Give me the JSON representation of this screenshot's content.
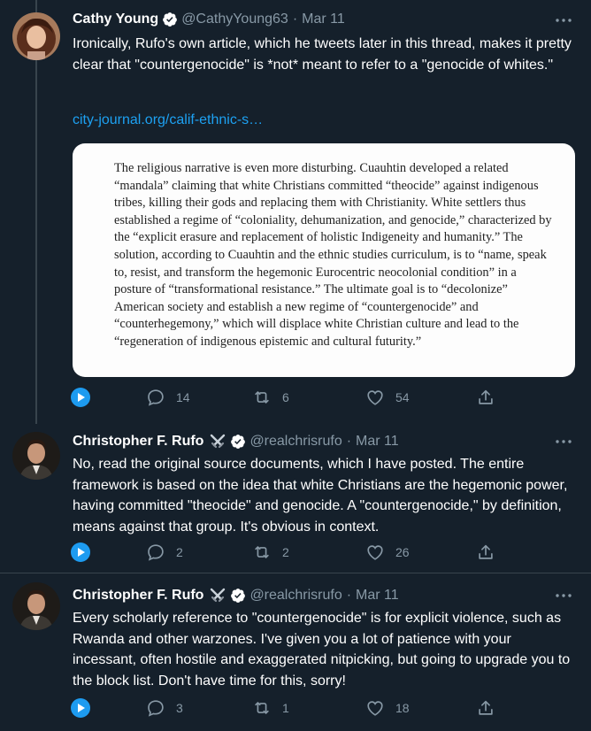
{
  "tweets": [
    {
      "name": "Cathy Young",
      "handle": "@CathyYoung63",
      "dot": "·",
      "date": "Mar 11",
      "text": "Ironically, Rufo's own article, which he tweets later in this thread, makes it pretty clear that \"countergenocide\" is *not* meant to refer to a \"genocide of whites.\"",
      "link": "city-journal.org/calif-ethnic-s…",
      "media_text": "The religious narrative is even more disturbing. Cuauhtin developed a related “mandala” claiming that white Christians committed “theocide” against indigenous tribes, killing their gods and replacing them with Christianity. White settlers thus established a regime of “coloniality, dehumanization, and genocide,” characterized by the “explicit erasure and replacement of holistic Indigeneity and humanity.” The solution, according to Cuauhtin and the ethnic studies curriculum, is to “name, speak to, resist, and transform the hegemonic Eurocentric neocolonial condition” in a posture of “transformational resistance.” The ultimate goal is to “decolonize” American society and establish a new regime of “countergenocide” and “counterhegemony,” which will displace white Christian culture and lead to the “regeneration of indigenous epistemic and cultural futurity.”",
      "replies": "14",
      "retweets": "6",
      "likes": "54"
    },
    {
      "name": "Christopher F. Rufo",
      "handle": "@realchrisrufo",
      "dot": "·",
      "date": "Mar 11",
      "text": "No, read the original source documents, which I have posted. The entire framework is based on the idea that white Christians are the hegemonic power, having committed \"theocide\" and genocide. A \"countergenocide,\" by definition, means against that group. It's obvious in context.",
      "replies": "2",
      "retweets": "2",
      "likes": "26"
    },
    {
      "name": "Christopher F. Rufo",
      "handle": "@realchrisrufo",
      "dot": "·",
      "date": "Mar 11",
      "text": "Every scholarly reference to \"countergenocide\" is for explicit violence, such as Rwanda and other warzones. I've given you a lot of patience with your incessant, often hostile and exaggerated nitpicking, but going to upgrade you to the block list. Don't have time for this, sorry!",
      "replies": "3",
      "retweets": "1",
      "likes": "18"
    }
  ],
  "icons": {
    "verified": "verified-badge-icon",
    "swords": "crossed-swords-icon",
    "more": "more-icon",
    "play": "play-icon",
    "reply": "reply-icon",
    "retweet": "retweet-icon",
    "like": "like-icon",
    "share": "share-icon"
  },
  "colors": {
    "background": "#15202b",
    "accent": "#1da1f2",
    "muted": "#8899a6",
    "border": "#38444d"
  }
}
